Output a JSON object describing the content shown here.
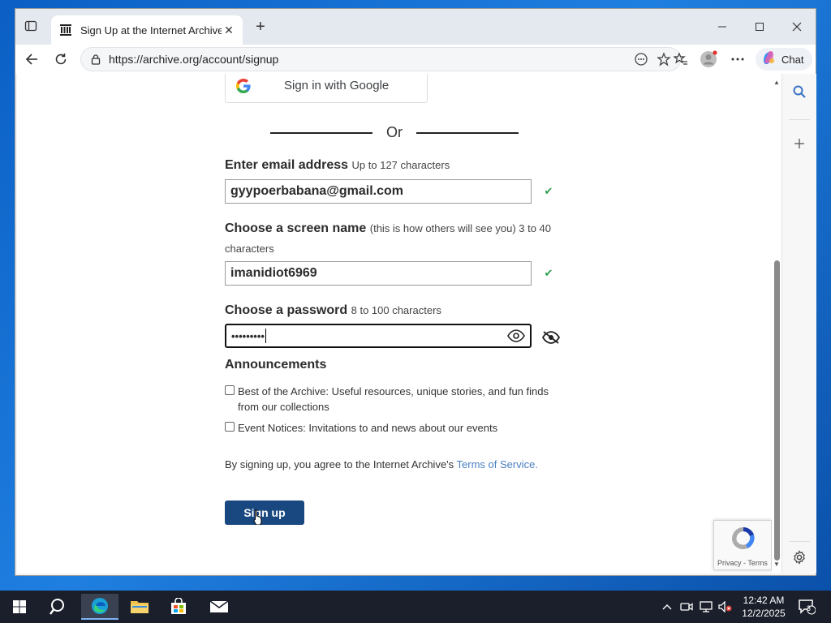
{
  "browser": {
    "tab_title": "Sign Up at the Internet Archive",
    "url": "https://archive.org/account/signup",
    "chat_label": "Chat"
  },
  "form": {
    "google_label": "Sign in with Google",
    "or_label": "Or",
    "email_label": "Enter email address",
    "email_hint": "Up to 127 characters",
    "email_value": "gyypoerbabana@gmail.com",
    "screen_label": "Choose a screen name",
    "screen_hint": "(this is how others will see you) 3 to 40",
    "screen_hint_2": "characters",
    "screen_value": "imanidiot6969",
    "password_label": "Choose a password",
    "password_hint": "8 to 100 characters",
    "password_value": "•••••••••",
    "announcements_title": "Announcements",
    "announcement_1": "Best of the Archive: Useful resources, unique stories, and fun finds from our collections",
    "announcement_2": "Event Notices: Invitations to and news about our events",
    "terms_prefix": "By signing up, you agree to the Internet Archive's",
    "terms_link": "Terms of Service.",
    "signup_label": "Sign up",
    "recaptcha_text": "Privacy - Terms"
  },
  "taskbar": {
    "time": "12:42 AM",
    "date": "12/2/2025",
    "notifications": "3"
  },
  "colors": {
    "accent": "#194880",
    "link": "#4a7fc1",
    "check": "#2a9d4a"
  }
}
